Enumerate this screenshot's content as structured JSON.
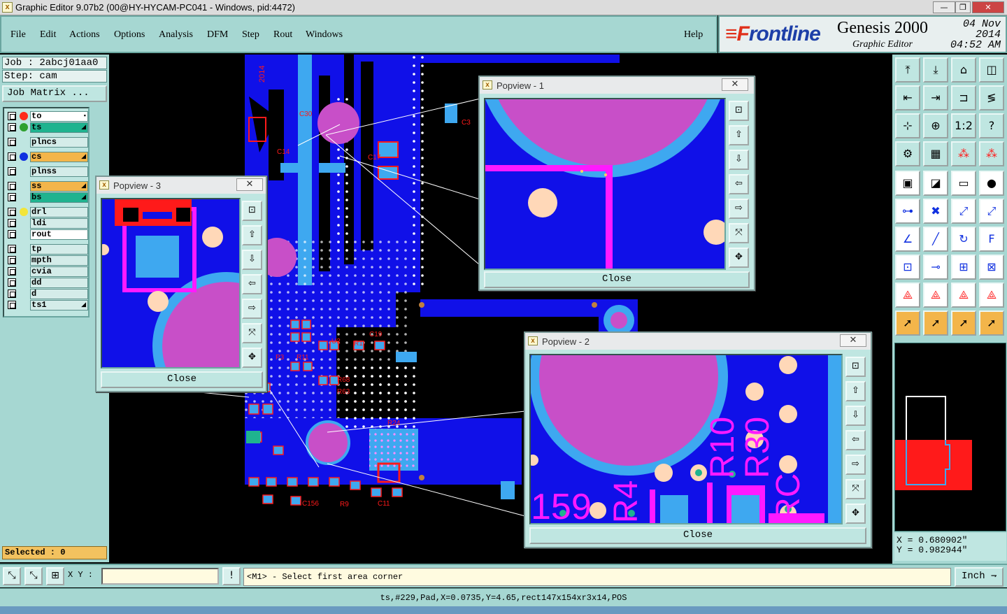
{
  "window": {
    "title": "Graphic Editor 9.07b2 (00@HY-HYCAM-PC041 - Windows, pid:4472)",
    "min": "—",
    "max": "❐",
    "close": "✕"
  },
  "menu": [
    "File",
    "Edit",
    "Actions",
    "Options",
    "Analysis",
    "DFM",
    "Step",
    "Rout",
    "Windows"
  ],
  "help": "Help",
  "brand": {
    "logo_f": "≡F",
    "logo_rest": "rontline",
    "product": "Genesis 2000",
    "subtitle": "Graphic Editor",
    "date": "04 Nov 2014",
    "time": "04:52 AM"
  },
  "job": {
    "job": "Job : 2abcj01aa0",
    "step": "Step: cam",
    "matrix": "Job Matrix ..."
  },
  "layers": [
    {
      "name": "to",
      "dot": "#ff2a1a",
      "bg": "#ffffff",
      "mark": "▪"
    },
    {
      "name": "ts",
      "dot": "#2fa02f",
      "bg": "#1fb38f",
      "mark": "◢"
    },
    {
      "name": "plncs",
      "dot": "",
      "bg": "#d4ece9",
      "mark": ""
    },
    {
      "name": "cs",
      "dot": "#1030e0",
      "bg": "#f3b54a",
      "mark": "◢"
    },
    {
      "name": "plnss",
      "dot": "",
      "bg": "#d4ece9",
      "mark": ""
    },
    {
      "name": "ss",
      "dot": "",
      "bg": "#f3b54a",
      "mark": "◢"
    },
    {
      "name": "bs",
      "dot": "",
      "bg": "#1fb38f",
      "mark": "◢"
    },
    {
      "name": "drl",
      "dot": "#f2e53a",
      "bg": "#d4ece9",
      "mark": ""
    },
    {
      "name": "ldi",
      "dot": "",
      "bg": "#d4ece9",
      "mark": ""
    },
    {
      "name": "rout",
      "dot": "",
      "bg": "#ffffff",
      "mark": ""
    },
    {
      "name": "tp",
      "dot": "",
      "bg": "#d4ece9",
      "mark": ""
    },
    {
      "name": "mpth",
      "dot": "",
      "bg": "#d4ece9",
      "mark": ""
    },
    {
      "name": "cvia",
      "dot": "",
      "bg": "#d4ece9",
      "mark": ""
    },
    {
      "name": "dd",
      "dot": "",
      "bg": "#d4ece9",
      "mark": ""
    },
    {
      "name": "d",
      "dot": "",
      "bg": "#d4ece9",
      "mark": ""
    },
    {
      "name": "ts1",
      "dot": "",
      "bg": "#d4ece9",
      "mark": "◢"
    }
  ],
  "selected": "Selected : 0",
  "popups": {
    "p1": {
      "title": "Popview - 1",
      "close": "Close"
    },
    "p2": {
      "title": "Popview - 2",
      "close": "Close"
    },
    "p3": {
      "title": "Popview - 3",
      "close": "Close"
    }
  },
  "popup_tools": [
    "⊡",
    "⇧",
    "⇩",
    "⇦",
    "⇨",
    "⤧",
    "✥"
  ],
  "right_tools": [
    [
      "⤒",
      "⤓",
      "⌂",
      "◫"
    ],
    [
      "⇤",
      "⇥",
      "⊐",
      "≶"
    ],
    [
      "⊹",
      "⊕",
      "1:2",
      "?"
    ],
    [
      "⚙",
      "▦",
      "⁂",
      "⁂"
    ],
    [
      "▣",
      "◪",
      "▭",
      "●"
    ],
    [
      "⊶",
      "✖",
      "⤢",
      "⤢"
    ],
    [
      "∠",
      "╱",
      "↻",
      "F"
    ],
    [
      "⊡",
      "⊸",
      "⊞",
      "⊠"
    ],
    [
      "⟁",
      "⟁",
      "⟁",
      "⟁"
    ],
    [
      "➚",
      "➚",
      "➚",
      "➚"
    ]
  ],
  "coords": {
    "x": "X = 0.680902\"",
    "y": "Y = 0.982944\""
  },
  "bottom": {
    "xy_label": "X Y :",
    "bang": "!",
    "prompt": "<M1> - Select first area corner",
    "units": "Inch",
    "units_arrow": "⇁"
  },
  "bottom_tools": [
    "⤡",
    "⤡",
    "⊞"
  ],
  "status": "ts,#229,Pad,X=0.0735,Y=4.65,rect147x154xr3x14,POS",
  "canvas_labels": {
    "p2": [
      "159",
      "R4",
      "R10",
      "R30",
      "RC"
    ],
    "board": [
      "C14",
      "C17",
      "P3",
      "R11",
      "U2",
      "R1",
      "C19",
      "R68",
      "R63",
      "R24",
      "C156",
      "R9",
      "C11",
      "C30",
      "C3",
      "2014"
    ]
  },
  "colors": {
    "teal": "#a6d7d2",
    "board_blue": "#1010e8",
    "copper_light": "#3ea8f0",
    "magenta": "#c84fc8",
    "red": "#ff1a1a"
  }
}
